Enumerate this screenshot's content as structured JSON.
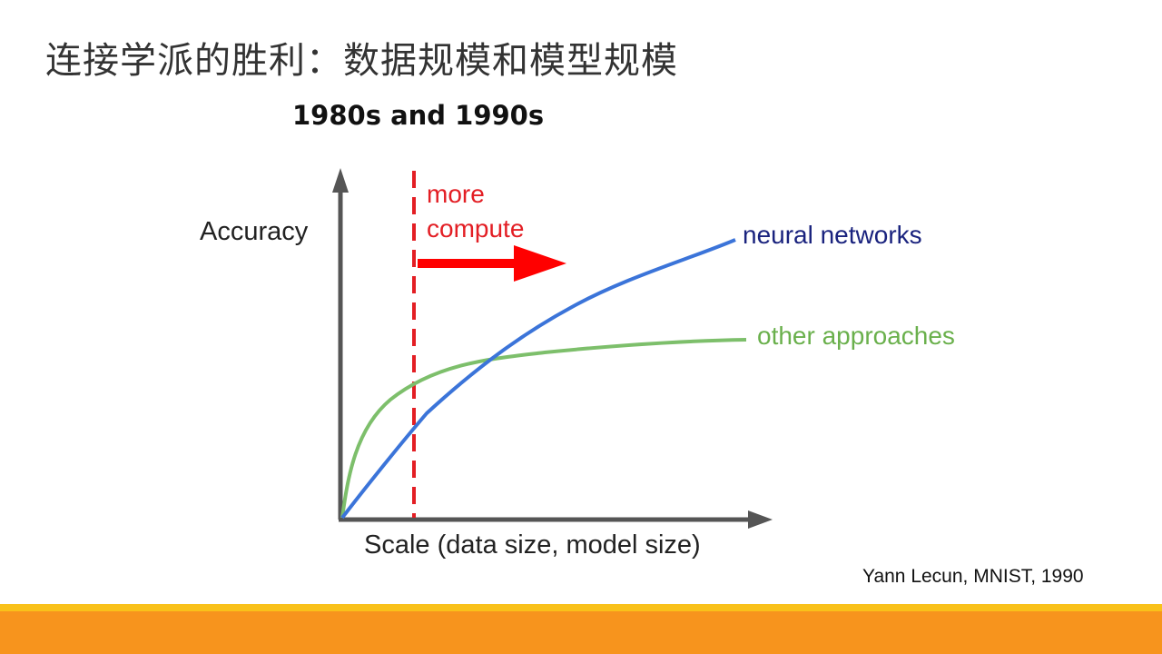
{
  "slide": {
    "title": "连接学派的胜利：数据规模和模型规模",
    "citation": "Yann Lecun, MNIST,  1990"
  },
  "diagram": {
    "heading": "1980s and 1990s",
    "y_axis_label": "Accuracy",
    "x_axis_label": "Scale (data size, model size)",
    "marker_label_line1": "more",
    "marker_label_line2": "compute",
    "curves": [
      {
        "name": "neural networks",
        "color": "#3b74d9"
      },
      {
        "name": "other approaches",
        "color": "#7dbf6b"
      }
    ],
    "marker_color": "#e31e24",
    "axis_color": "#555555",
    "neural_label_color": "#1a237e",
    "other_label_color": "#6ab04c"
  },
  "colors": {
    "footer_orange": "#f7941d",
    "footer_yellow": "#f9c11a"
  }
}
